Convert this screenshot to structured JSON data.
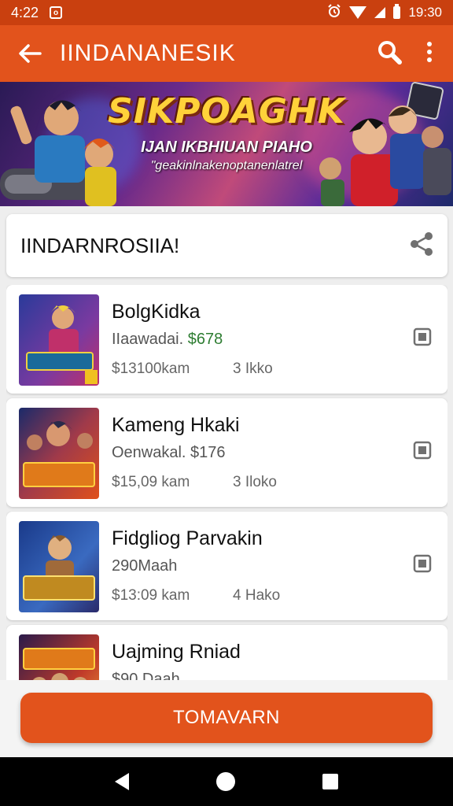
{
  "status_bar": {
    "time": "4:22",
    "clock": "19:30",
    "icons": [
      "notification-icon",
      "alarm-icon",
      "wifi-icon",
      "signal-icon",
      "battery-icon"
    ]
  },
  "app_bar": {
    "title": "IINDANANESIK",
    "back_icon": "arrow-left-icon",
    "actions": [
      "search-icon",
      "more-vert-icon"
    ]
  },
  "banner": {
    "title": "SIKPOAGHK",
    "subtitle": "IJAN IKBHIUAN PIAHO",
    "tagline": "\"geakinlnakenoptanenlatrel"
  },
  "section": {
    "title": "IINDARNROSIIA!",
    "share_icon": "share-icon"
  },
  "items": [
    {
      "name": "BolgKidka",
      "price_label": "IIaawadai. ",
      "price_value": "$678",
      "price_value_color": "#2e7d32",
      "distance": "$13100kam",
      "count": "3 Ikko",
      "thumb_text": "SANDIHUK",
      "thumb_colors": [
        "#2a3a9a",
        "#c0306a",
        "#f0a020"
      ]
    },
    {
      "name": "Kameng Hkaki",
      "price_label": "Oenwakal. $176",
      "price_value": "",
      "distance": "$15,09 kam",
      "count": "3 Iloko",
      "thumb_text": "SPNIENE WAKAF",
      "thumb_colors": [
        "#1a2a6a",
        "#e0501a",
        "#ffb020"
      ]
    },
    {
      "name": "Fidgliog Parvakin",
      "price_label": "290Maah",
      "price_value": "",
      "distance": "$13:09 kam",
      "count": "4 Hako",
      "thumb_text": "DUPANIMAE",
      "thumb_colors": [
        "#1a3a8a",
        "#3a6ac0",
        "#f0c040"
      ]
    },
    {
      "name": "Uajming Rniad",
      "price_label": "$90.Daah",
      "price_value": "",
      "distance": "",
      "count": "",
      "thumb_text": "DUKNAKAS",
      "thumb_colors": [
        "#2a1a4a",
        "#c03a2a",
        "#f0a030"
      ]
    }
  ],
  "cta": {
    "label": "TOMAVARN"
  },
  "nav_bar": [
    "nav-back-icon",
    "nav-home-icon",
    "nav-recents-icon"
  ],
  "colors": {
    "primary": "#e2531c",
    "status_bar": "#c9400f",
    "price_green": "#2e7d32"
  }
}
